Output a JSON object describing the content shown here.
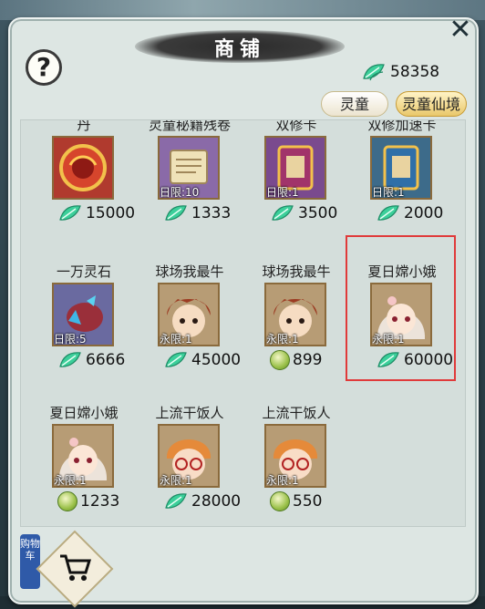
{
  "title": "商铺",
  "close_label": "✕",
  "help_label": "?",
  "currency": {
    "value": "58358",
    "icon": "jade-leaf-icon"
  },
  "tabs": [
    {
      "label": "灵童"
    },
    {
      "label": "灵童仙境"
    }
  ],
  "items": [
    {
      "name": "丹",
      "limit": "",
      "price": "15000",
      "currency": "leaf",
      "icon": "red-pill"
    },
    {
      "name": "灵童秘籍残卷",
      "limit": "日限:10",
      "price": "1333",
      "currency": "leaf",
      "icon": "scroll"
    },
    {
      "name": "双修卡",
      "limit": "日限:1",
      "price": "3500",
      "currency": "leaf",
      "icon": "purple-card"
    },
    {
      "name": "双修加速卡",
      "limit": "日限:1",
      "price": "2000",
      "currency": "leaf",
      "icon": "blue-card"
    },
    {
      "name": "一万灵石",
      "limit": "日限:5",
      "price": "6666",
      "currency": "leaf",
      "icon": "spirit-stone-bag"
    },
    {
      "name": "球场我最牛",
      "limit": "永限:1",
      "price": "45000",
      "currency": "leaf",
      "icon": "boy-red"
    },
    {
      "name": "球场我最牛",
      "limit": "永限:1",
      "price": "899",
      "currency": "coin",
      "icon": "boy-red"
    },
    {
      "name": "夏日嫦小娥",
      "limit": "永限:1",
      "price": "60000",
      "currency": "leaf",
      "icon": "girl-white"
    },
    {
      "name": "夏日嫦小娥",
      "limit": "永限:1",
      "price": "1233",
      "currency": "coin",
      "icon": "girl-white"
    },
    {
      "name": "上流干饭人",
      "limit": "永限:1",
      "price": "28000",
      "currency": "leaf",
      "icon": "boy-orange"
    },
    {
      "name": "上流干饭人",
      "limit": "永限:1",
      "price": "550",
      "currency": "coin",
      "icon": "boy-orange"
    }
  ],
  "cart_label": "购物车",
  "colors": {
    "highlight": "#e03a3a",
    "leaf": "#3ccf9a",
    "panel": "#dde6e3"
  }
}
